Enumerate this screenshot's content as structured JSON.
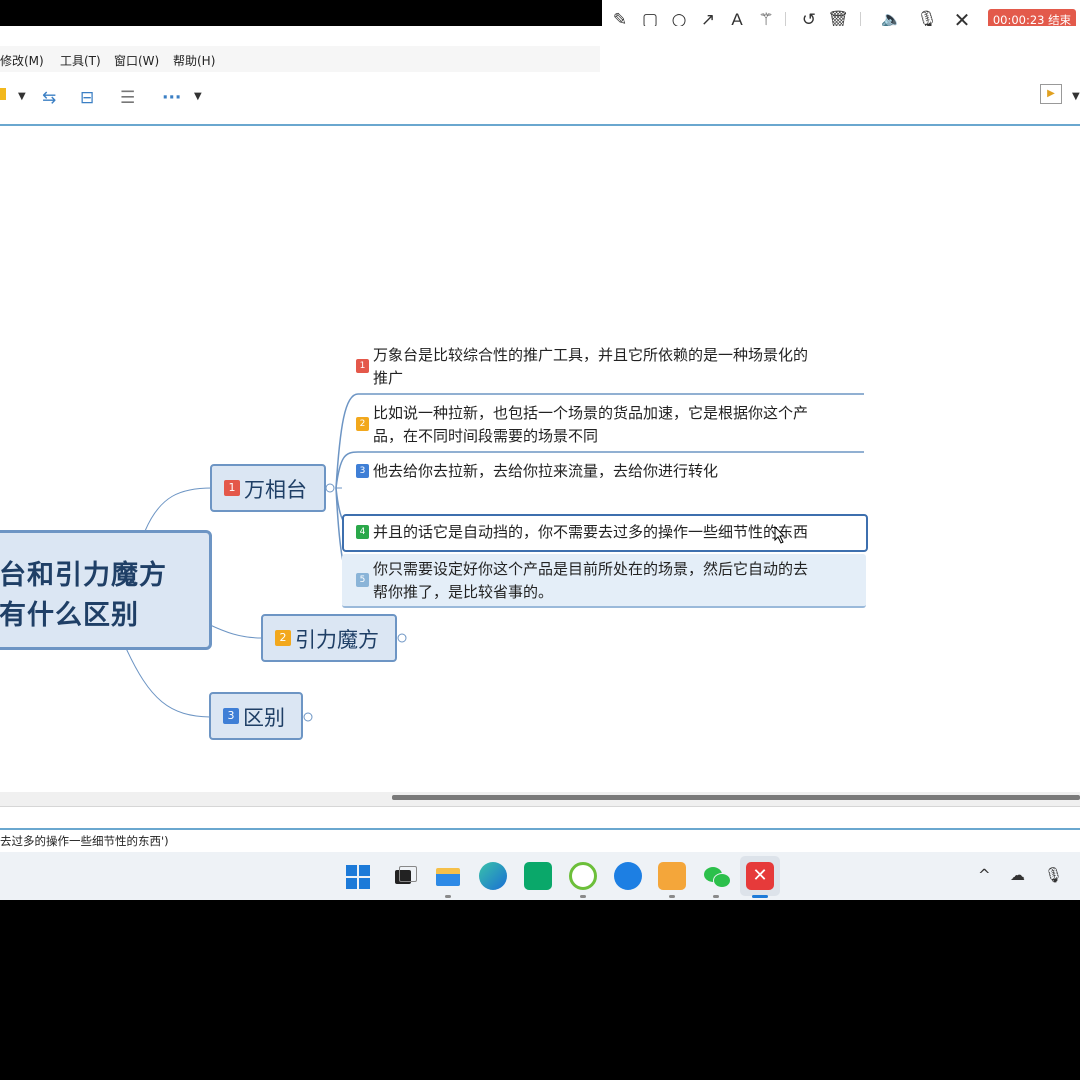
{
  "menu": [
    "修改(M)",
    "工具(T)",
    "窗口(W)",
    "帮助(H)"
  ],
  "recorder": {
    "timer": "00:00:23 结束",
    "icons": [
      "pencil-icon",
      "rectangle-icon",
      "circle-icon",
      "arrow-icon",
      "text-icon",
      "magic-wand-icon",
      "undo-icon",
      "trash-icon",
      "speaker-icon",
      "microphone-icon",
      "close-icon"
    ]
  },
  "toolbar": {
    "icons": [
      "color-icon",
      "relationship-icon",
      "boundary-icon",
      "summary-icon",
      "more-icon",
      "presentation-icon"
    ]
  },
  "mindmap": {
    "central": {
      "line1": "台和引力魔方",
      "line2": "有什么区别"
    },
    "branches": [
      {
        "num": "1",
        "label": "万相台",
        "color": "#e4584a"
      },
      {
        "num": "2",
        "label": "引力魔方",
        "color": "#f2a81d"
      },
      {
        "num": "3",
        "label": "区别",
        "color": "#3f7fd6"
      }
    ],
    "leaves": [
      {
        "num": "1",
        "color": "#e4584a",
        "line1": "万象台是比较综合性的推广工具，并且它所依赖的是一种场景化的",
        "line2": "推广"
      },
      {
        "num": "2",
        "color": "#f2a81d",
        "line1": "比如说一种拉新，也包括一个场景的货品加速，它是根据你这个产",
        "line2": "品，在不同时间段需要的场景不同"
      },
      {
        "num": "3",
        "color": "#3f7fd6",
        "line1": "他去给你去拉新，去给你拉来流量，去给你进行转化",
        "line2": ""
      },
      {
        "num": "4",
        "color": "#2aa84a",
        "line1": "并且的话它是自动挡的，你不需要去过多的操作一些细节性的东西",
        "line2": ""
      },
      {
        "num": "5",
        "color": "#8ab4d8",
        "line1": "你只需要设定好你这个产品是目前所处在的场景，然后它自动的去",
        "line2": "帮你推了，是比较省事的。"
      }
    ]
  },
  "status": {
    "text": "去过多的操作一些细节性的东西')"
  },
  "taskbar": {
    "apps": [
      "windows-start-icon",
      "task-view-icon",
      "file-explorer-icon",
      "edge-icon",
      "store-icon",
      "ie-icon",
      "browser-icon",
      "photos-icon",
      "wechat-icon",
      "xmind-icon"
    ],
    "tray": [
      "chevron-up-icon",
      "cloud-icon",
      "microphone-icon"
    ]
  }
}
